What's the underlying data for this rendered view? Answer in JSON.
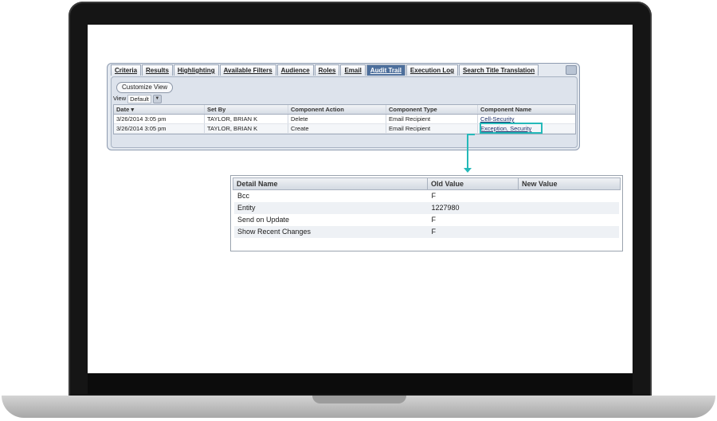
{
  "tabs": [
    {
      "label": "Criteria",
      "active": false
    },
    {
      "label": "Results",
      "active": false
    },
    {
      "label": "Highlighting",
      "active": false
    },
    {
      "label": "Available Filters",
      "active": false
    },
    {
      "label": "Audience",
      "active": false
    },
    {
      "label": "Roles",
      "active": false
    },
    {
      "label": "Email",
      "active": false
    },
    {
      "label": "Audit Trail",
      "active": true
    },
    {
      "label": "Execution Log",
      "active": false
    },
    {
      "label": "Search Title Translation",
      "active": false
    }
  ],
  "toolbar": {
    "customize_label": "Customize View",
    "view_label": "View",
    "view_value": "Default"
  },
  "audit_grid": {
    "columns": [
      "Date ▾",
      "Set By",
      "Component Action",
      "Component Type",
      "Component Name"
    ],
    "rows": [
      [
        "3/26/2014 3:05 pm",
        "TAYLOR, BRIAN K",
        "Delete",
        "Email Recipient",
        "Cell-Security"
      ],
      [
        "3/26/2014 3:05 pm",
        "TAYLOR, BRIAN K",
        "Create",
        "Email Recipient",
        "Exception, Security"
      ]
    ]
  },
  "detail_grid": {
    "columns": [
      "Detail Name",
      "Old Value",
      "New Value"
    ],
    "rows": [
      [
        "Bcc",
        "F",
        ""
      ],
      [
        "Entity",
        "1227980",
        ""
      ],
      [
        "Send on Update",
        "F",
        ""
      ],
      [
        "Show Recent Changes",
        "F",
        ""
      ]
    ]
  },
  "colors": {
    "active_tab": "#4d6f9c",
    "callout": "#25b9b9",
    "laptop_bezel": "#151515"
  }
}
